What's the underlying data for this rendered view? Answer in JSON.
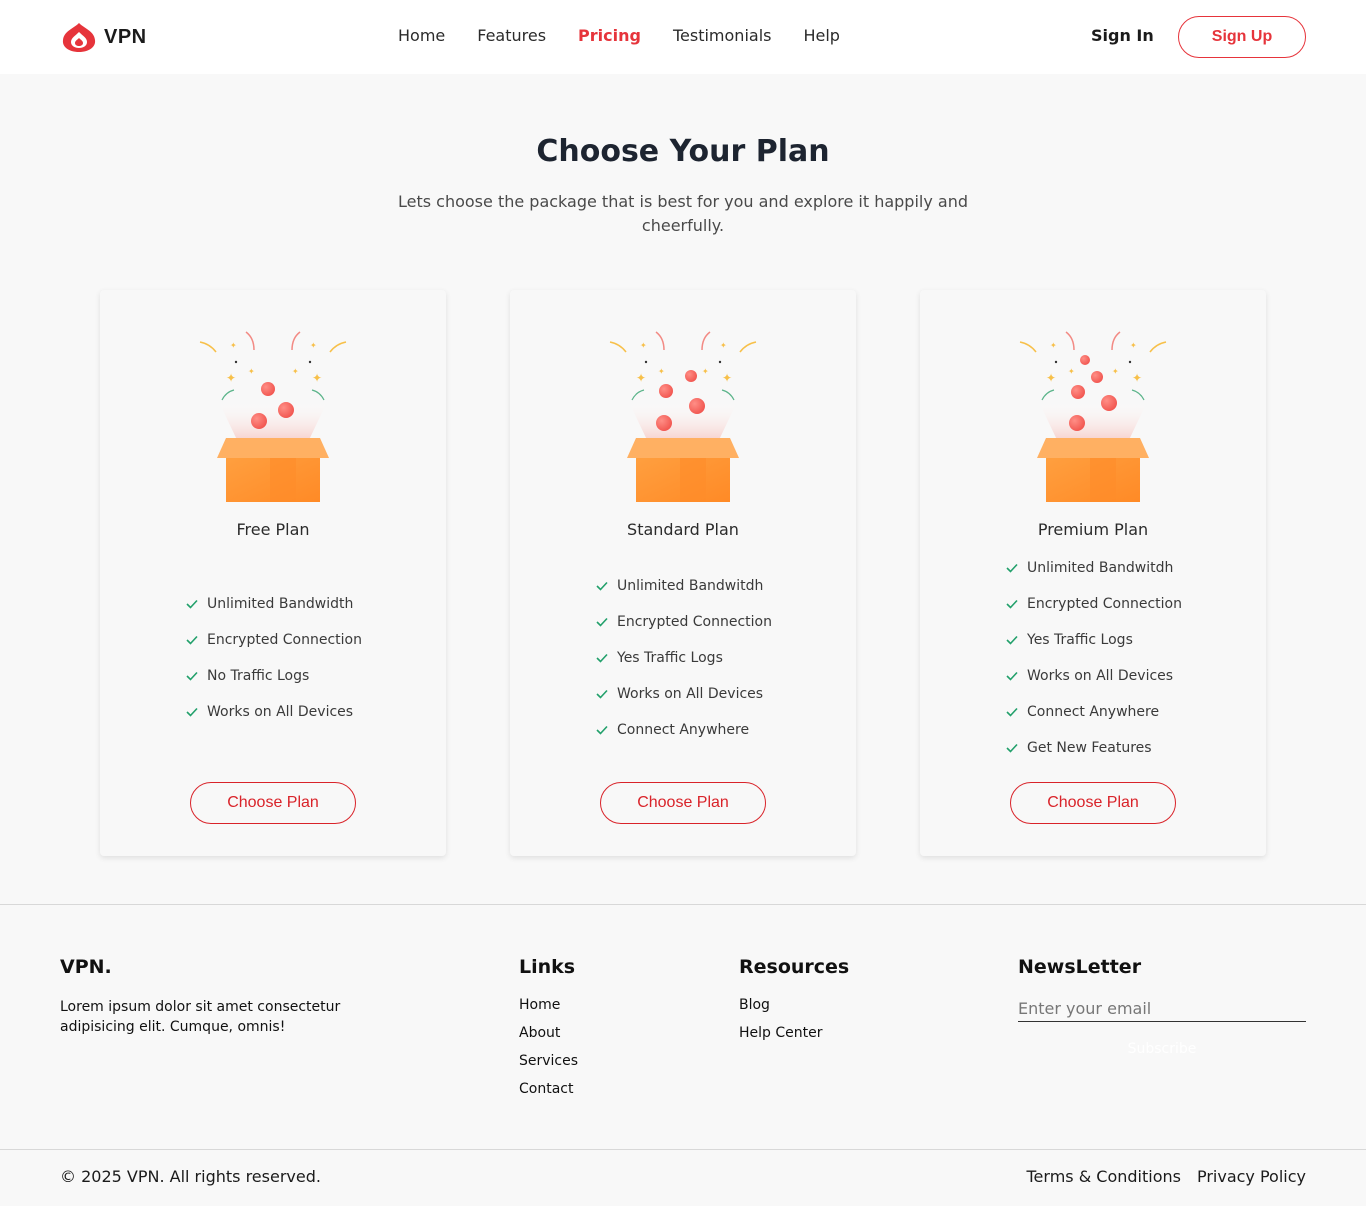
{
  "header": {
    "logo_text": "VPN",
    "nav": [
      "Home",
      "Features",
      "Pricing",
      "Testimonials",
      "Help"
    ],
    "active_nav": "Pricing",
    "signin_label": "Sign In",
    "signup_label": "Sign Up",
    "accent_color": "#e6343b"
  },
  "hero": {
    "title": "Choose Your Plan",
    "subtitle": "Lets choose the package that is best for you and explore it happily and cheerfully."
  },
  "plans": [
    {
      "name": "Free Plan",
      "features": [
        "Unlimited Bandwidth",
        "Encrypted Connection",
        "No Traffic Logs",
        "Works on All Devices"
      ],
      "button_label": "Choose Plan"
    },
    {
      "name": "Standard Plan",
      "features": [
        "Unlimited Bandwitdh",
        "Encrypted Connection",
        "Yes Traffic Logs",
        "Works on All Devices",
        "Connect Anywhere"
      ],
      "button_label": "Choose Plan"
    },
    {
      "name": "Premium Plan",
      "features": [
        "Unlimited Bandwitdh",
        "Encrypted Connection",
        "Yes Traffic Logs",
        "Works on All Devices",
        "Connect Anywhere",
        "Get New Features"
      ],
      "button_label": "Choose Plan"
    }
  ],
  "footer": {
    "brand": "VPN.",
    "description": "Lorem ipsum dolor sit amet consectetur adipisicing elit. Cumque, omnis!",
    "links_title": "Links",
    "links": [
      "Home",
      "About",
      "Services",
      "Contact"
    ],
    "resources_title": "Resources",
    "resources": [
      "Blog",
      "Help Center"
    ],
    "newsletter_title": "NewsLetter",
    "email_placeholder": "Enter your email",
    "subscribe_label": "Subscribe",
    "copyright": "© 2025 VPN. All rights reserved.",
    "legal": [
      "Terms & Conditions",
      "Privacy Policy"
    ]
  }
}
